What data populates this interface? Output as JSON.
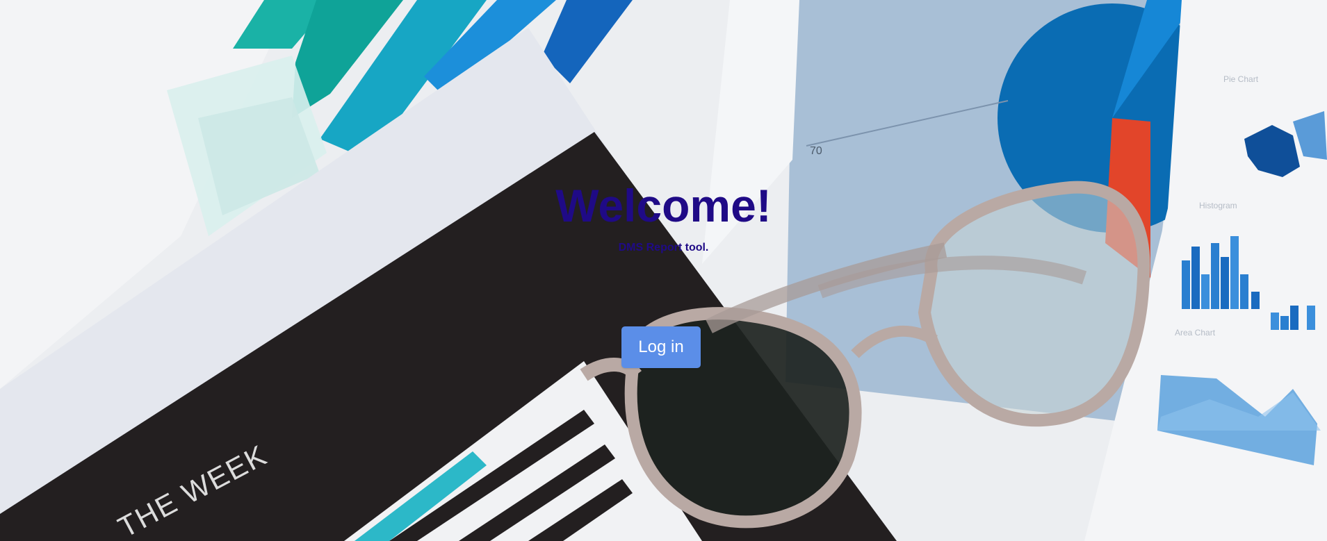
{
  "hero": {
    "title": "Welcome!",
    "subtitle": "DMS Report tool."
  },
  "actions": {
    "login_label": "Log in"
  },
  "background": {
    "cover_text": "THE WEEK",
    "pie_label": "70",
    "panel_labels": [
      "Pie Chart",
      "Histogram",
      "Area Chart"
    ]
  },
  "colors": {
    "title": "#1f0a86",
    "button": "#5b8ee8",
    "button_text": "#ffffff"
  }
}
